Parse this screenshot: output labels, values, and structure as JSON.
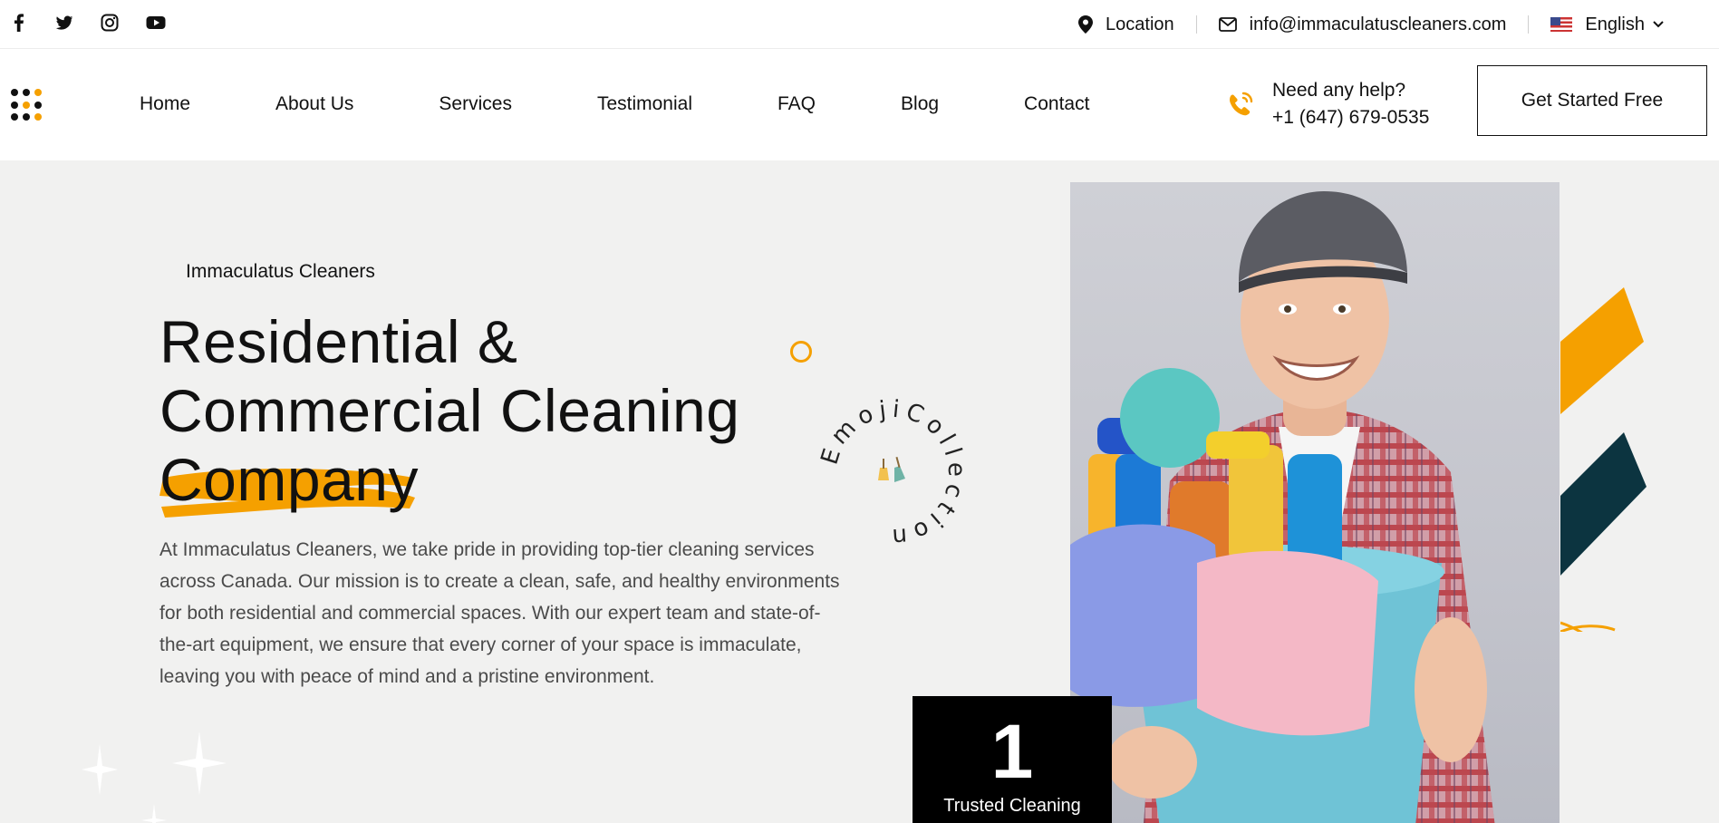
{
  "topbar": {
    "social_icons": [
      "facebook-icon",
      "twitter-icon",
      "instagram-icon",
      "youtube-icon"
    ],
    "location_label": "Location",
    "email": "info@immaculatuscleaners.com",
    "language": "English"
  },
  "nav": {
    "items": [
      "Home",
      "About Us",
      "Services",
      "Testimonial",
      "FAQ",
      "Blog",
      "Contact"
    ],
    "help_title": "Need any help?",
    "help_phone": "+1 (647) 679-0535",
    "cta_label": "Get Started Free"
  },
  "hero": {
    "eyebrow": "Immaculatus Cleaners",
    "headline_line1": "Residential &",
    "headline_line2": "Commercial Cleaning",
    "headline_highlight": "Company",
    "description": "At Immaculatus Cleaners, we take pride in providing top-tier cleaning services across Canada. Our mission is to create a clean, safe, and healthy environments for both residential and commercial spaces. With our expert team and state-of-the-art equipment, we ensure that every corner of your space is immaculate, leaving you with peace of mind and a pristine environment.",
    "badge_text": "EmojiCollection",
    "stat_number": "1",
    "stat_label": "Trusted Cleaning"
  },
  "colors": {
    "accent": "#f5a000",
    "dark_teal": "#0c3440",
    "hero_bg": "#f1f1f0"
  }
}
